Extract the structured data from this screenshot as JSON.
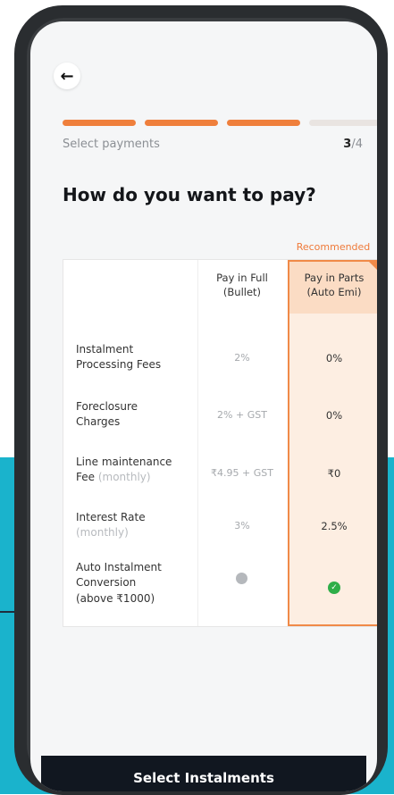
{
  "header": {
    "back_icon": "arrow-left-icon",
    "step_label": "Select payments",
    "step_current": "3",
    "step_total": "/4",
    "progress_filled_steps": 3,
    "progress_total_steps": 4,
    "title": "How do you want to pay?"
  },
  "comparison": {
    "recommended_label": "Recommended",
    "columns": [
      {
        "line1": "Pay in Full",
        "line2": "(Bullet)"
      },
      {
        "line1": "Pay in Parts",
        "line2": "(Auto Emi)"
      }
    ],
    "rows": [
      {
        "label": "Instalment Processing Fees",
        "suffix": "",
        "full": "2%",
        "parts": "0%"
      },
      {
        "label": "Foreclosure Charges",
        "suffix": "",
        "full": "2% + GST",
        "parts": "0%"
      },
      {
        "label": "Line maintenance Fee",
        "suffix": "(monthly)",
        "full": "₹4.95 + GST",
        "parts": "₹0"
      },
      {
        "label": "Interest Rate",
        "suffix": "(monthly)",
        "full": "3%",
        "parts": "2.5%"
      },
      {
        "label": "Auto Instalment Conversion (above ₹1000)",
        "suffix": "",
        "full_icon": "grey-dot-icon",
        "parts_icon": "green-check-icon"
      }
    ]
  },
  "cta": {
    "label": "Select Instalments"
  },
  "colors": {
    "accent": "#f08a48",
    "accent_light": "#fdeee2",
    "teal": "#1ab3cc",
    "cta_bg": "#111720",
    "check_green": "#2fae49"
  }
}
